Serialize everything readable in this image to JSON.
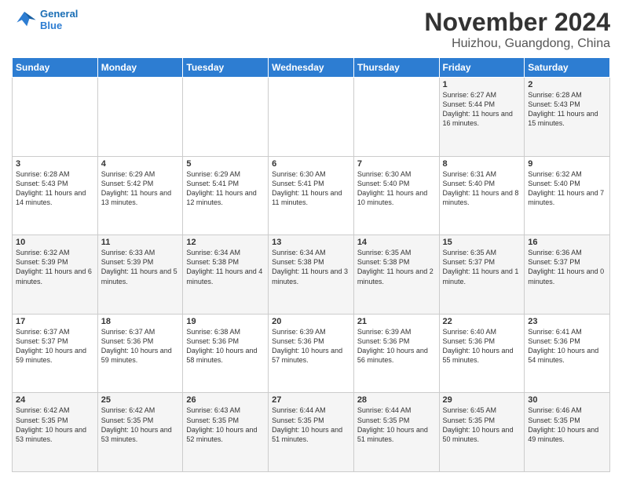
{
  "header": {
    "logo_line1": "General",
    "logo_line2": "Blue",
    "main_title": "November 2024",
    "subtitle": "Huizhou, Guangdong, China"
  },
  "weekdays": [
    "Sunday",
    "Monday",
    "Tuesday",
    "Wednesday",
    "Thursday",
    "Friday",
    "Saturday"
  ],
  "weeks": [
    [
      {
        "day": "",
        "info": ""
      },
      {
        "day": "",
        "info": ""
      },
      {
        "day": "",
        "info": ""
      },
      {
        "day": "",
        "info": ""
      },
      {
        "day": "",
        "info": ""
      },
      {
        "day": "1",
        "info": "Sunrise: 6:27 AM\nSunset: 5:44 PM\nDaylight: 11 hours and 16 minutes."
      },
      {
        "day": "2",
        "info": "Sunrise: 6:28 AM\nSunset: 5:43 PM\nDaylight: 11 hours and 15 minutes."
      }
    ],
    [
      {
        "day": "3",
        "info": "Sunrise: 6:28 AM\nSunset: 5:43 PM\nDaylight: 11 hours and 14 minutes."
      },
      {
        "day": "4",
        "info": "Sunrise: 6:29 AM\nSunset: 5:42 PM\nDaylight: 11 hours and 13 minutes."
      },
      {
        "day": "5",
        "info": "Sunrise: 6:29 AM\nSunset: 5:41 PM\nDaylight: 11 hours and 12 minutes."
      },
      {
        "day": "6",
        "info": "Sunrise: 6:30 AM\nSunset: 5:41 PM\nDaylight: 11 hours and 11 minutes."
      },
      {
        "day": "7",
        "info": "Sunrise: 6:30 AM\nSunset: 5:40 PM\nDaylight: 11 hours and 10 minutes."
      },
      {
        "day": "8",
        "info": "Sunrise: 6:31 AM\nSunset: 5:40 PM\nDaylight: 11 hours and 8 minutes."
      },
      {
        "day": "9",
        "info": "Sunrise: 6:32 AM\nSunset: 5:40 PM\nDaylight: 11 hours and 7 minutes."
      }
    ],
    [
      {
        "day": "10",
        "info": "Sunrise: 6:32 AM\nSunset: 5:39 PM\nDaylight: 11 hours and 6 minutes."
      },
      {
        "day": "11",
        "info": "Sunrise: 6:33 AM\nSunset: 5:39 PM\nDaylight: 11 hours and 5 minutes."
      },
      {
        "day": "12",
        "info": "Sunrise: 6:34 AM\nSunset: 5:38 PM\nDaylight: 11 hours and 4 minutes."
      },
      {
        "day": "13",
        "info": "Sunrise: 6:34 AM\nSunset: 5:38 PM\nDaylight: 11 hours and 3 minutes."
      },
      {
        "day": "14",
        "info": "Sunrise: 6:35 AM\nSunset: 5:38 PM\nDaylight: 11 hours and 2 minutes."
      },
      {
        "day": "15",
        "info": "Sunrise: 6:35 AM\nSunset: 5:37 PM\nDaylight: 11 hours and 1 minute."
      },
      {
        "day": "16",
        "info": "Sunrise: 6:36 AM\nSunset: 5:37 PM\nDaylight: 11 hours and 0 minutes."
      }
    ],
    [
      {
        "day": "17",
        "info": "Sunrise: 6:37 AM\nSunset: 5:37 PM\nDaylight: 10 hours and 59 minutes."
      },
      {
        "day": "18",
        "info": "Sunrise: 6:37 AM\nSunset: 5:36 PM\nDaylight: 10 hours and 59 minutes."
      },
      {
        "day": "19",
        "info": "Sunrise: 6:38 AM\nSunset: 5:36 PM\nDaylight: 10 hours and 58 minutes."
      },
      {
        "day": "20",
        "info": "Sunrise: 6:39 AM\nSunset: 5:36 PM\nDaylight: 10 hours and 57 minutes."
      },
      {
        "day": "21",
        "info": "Sunrise: 6:39 AM\nSunset: 5:36 PM\nDaylight: 10 hours and 56 minutes."
      },
      {
        "day": "22",
        "info": "Sunrise: 6:40 AM\nSunset: 5:36 PM\nDaylight: 10 hours and 55 minutes."
      },
      {
        "day": "23",
        "info": "Sunrise: 6:41 AM\nSunset: 5:36 PM\nDaylight: 10 hours and 54 minutes."
      }
    ],
    [
      {
        "day": "24",
        "info": "Sunrise: 6:42 AM\nSunset: 5:35 PM\nDaylight: 10 hours and 53 minutes."
      },
      {
        "day": "25",
        "info": "Sunrise: 6:42 AM\nSunset: 5:35 PM\nDaylight: 10 hours and 53 minutes."
      },
      {
        "day": "26",
        "info": "Sunrise: 6:43 AM\nSunset: 5:35 PM\nDaylight: 10 hours and 52 minutes."
      },
      {
        "day": "27",
        "info": "Sunrise: 6:44 AM\nSunset: 5:35 PM\nDaylight: 10 hours and 51 minutes."
      },
      {
        "day": "28",
        "info": "Sunrise: 6:44 AM\nSunset: 5:35 PM\nDaylight: 10 hours and 51 minutes."
      },
      {
        "day": "29",
        "info": "Sunrise: 6:45 AM\nSunset: 5:35 PM\nDaylight: 10 hours and 50 minutes."
      },
      {
        "day": "30",
        "info": "Sunrise: 6:46 AM\nSunset: 5:35 PM\nDaylight: 10 hours and 49 minutes."
      }
    ]
  ]
}
